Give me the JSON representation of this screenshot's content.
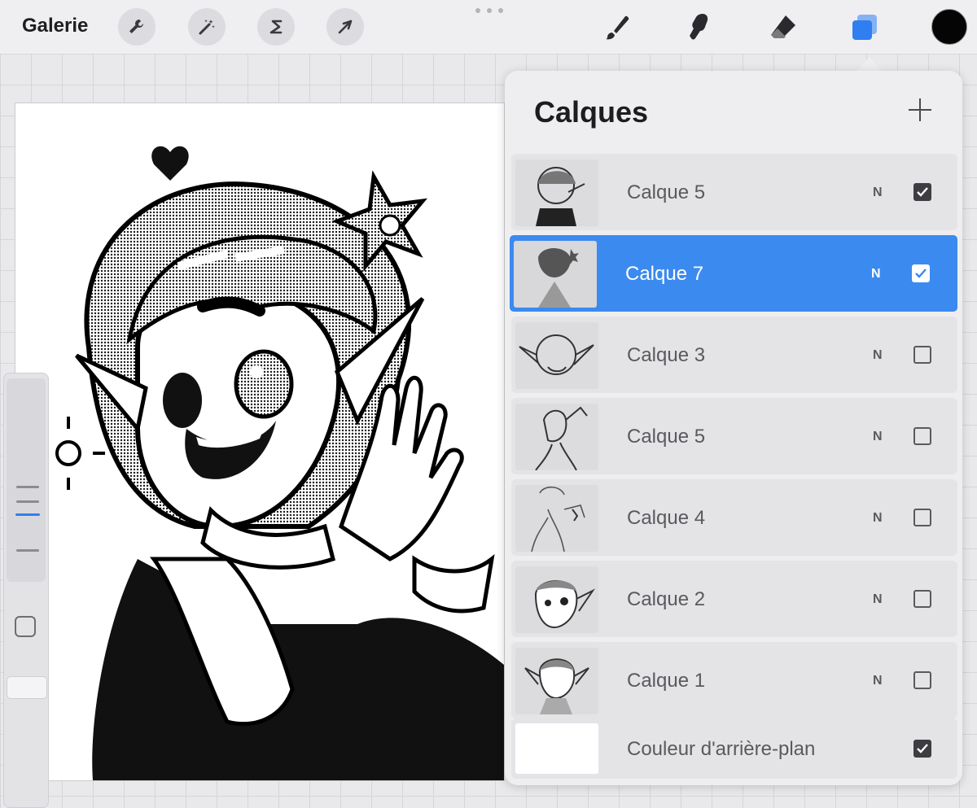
{
  "toolbar": {
    "gallery_label": "Galerie",
    "left_tools": [
      {
        "name": "wrench-icon"
      },
      {
        "name": "magic-wand-icon"
      },
      {
        "name": "selection-s-icon"
      },
      {
        "name": "transform-arrow-icon"
      }
    ],
    "right_tools": [
      {
        "name": "brush-icon"
      },
      {
        "name": "smudge-icon"
      },
      {
        "name": "eraser-icon"
      },
      {
        "name": "layers-icon",
        "active": true
      }
    ],
    "color": "#050505",
    "accent": "#2f7ff0"
  },
  "layers_panel": {
    "title": "Calques",
    "add_icon": "plus-icon",
    "layers": [
      {
        "name": "Calque 5",
        "blend": "N",
        "visible": true,
        "selected": false
      },
      {
        "name": "Calque 7",
        "blend": "N",
        "visible": true,
        "selected": true
      },
      {
        "name": "Calque 3",
        "blend": "N",
        "visible": false,
        "selected": false
      },
      {
        "name": "Calque 5",
        "blend": "N",
        "visible": false,
        "selected": false
      },
      {
        "name": "Calque 4",
        "blend": "N",
        "visible": false,
        "selected": false
      },
      {
        "name": "Calque 2",
        "blend": "N",
        "visible": false,
        "selected": false
      },
      {
        "name": "Calque 1",
        "blend": "N",
        "visible": false,
        "selected": false
      }
    ],
    "background_layer": {
      "name": "Couleur d'arrière-plan",
      "visible": true
    }
  }
}
